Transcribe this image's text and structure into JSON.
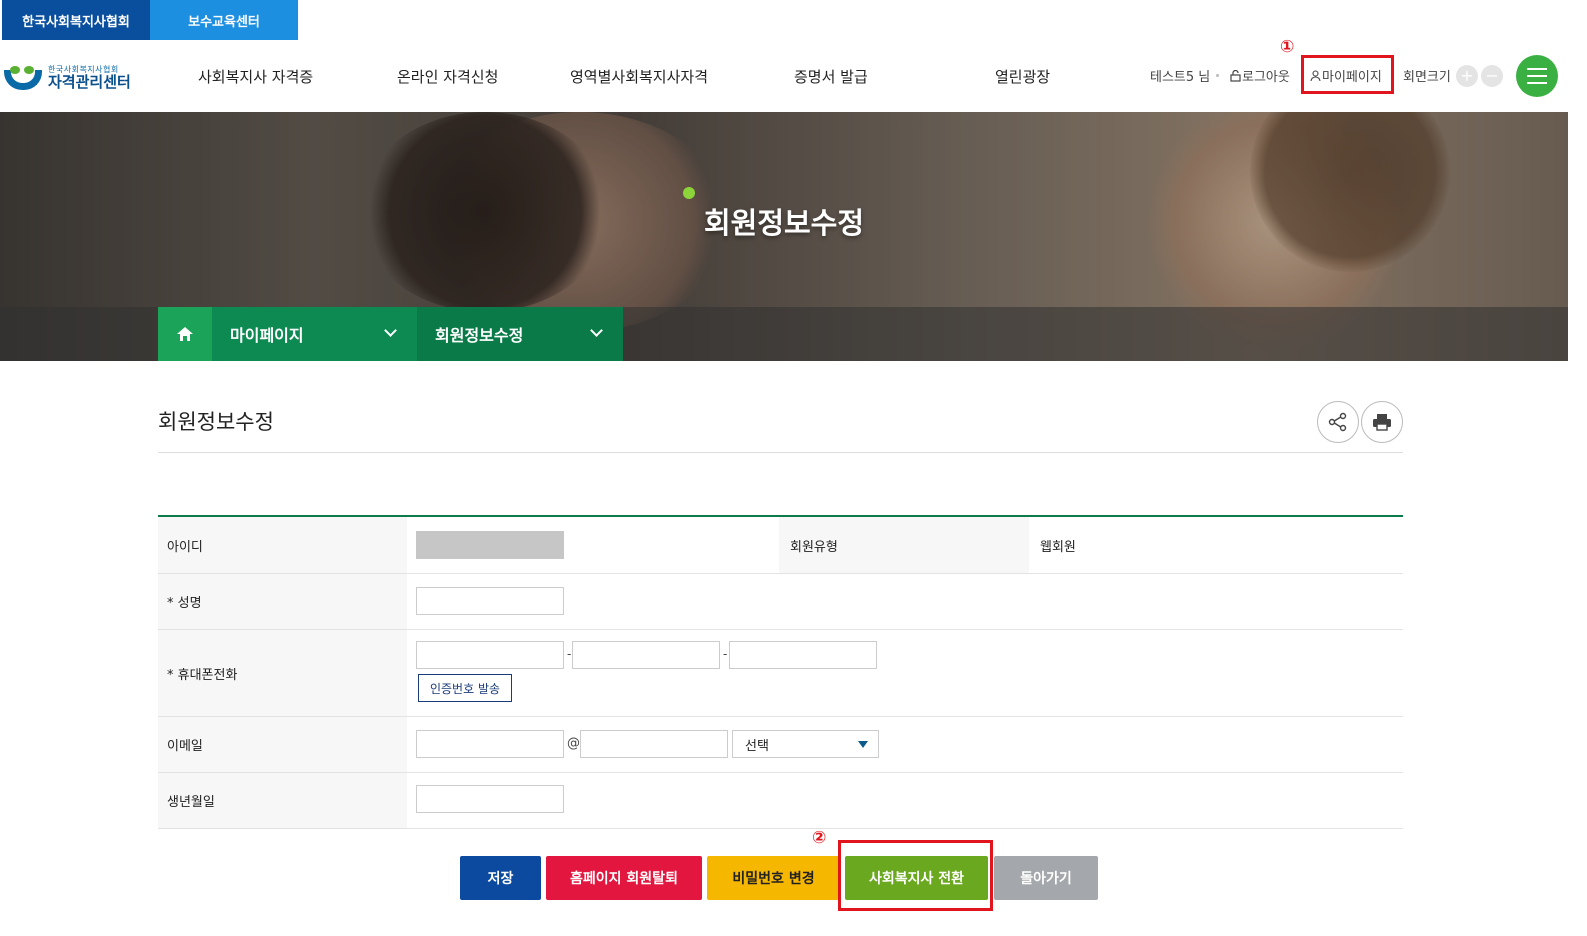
{
  "org_tabs": [
    "한국사회복지사협회",
    "보수교육센터"
  ],
  "logo": {
    "small": "한국사회복지사협회",
    "big": "자격관리센터"
  },
  "gnb": [
    "사회복지사 자격증",
    "온라인 자격신청",
    "영역별사회복지사자격",
    "증명서 발급",
    "열린광장"
  ],
  "util": {
    "user": "테스트5 님",
    "logout": "로그아웃",
    "mypage": "마이페이지",
    "font_size": "회면크기",
    "zoom_in": "+",
    "zoom_out": "−"
  },
  "annotations": {
    "step1": "①",
    "step2": "②"
  },
  "hero": {
    "title": "회원정보수정"
  },
  "breadcrumb": {
    "level1": "마이페이지",
    "level2": "회원정보수정"
  },
  "page": {
    "title": "회원정보수정"
  },
  "form": {
    "id_label": "아이디",
    "member_type_label": "회원유형",
    "member_type_value": "웹회원",
    "name_label": "* 성명",
    "phone_label": "* 휴대폰전화",
    "phone_dash": "-",
    "auth_button": "인증번호 발송",
    "email_label": "이메일",
    "email_at": "@",
    "email_select": "선택",
    "birth_label": "생년월일"
  },
  "buttons": {
    "save": "저장",
    "withdraw": "홈페이지 회원탈퇴",
    "change_pw": "비밀번호 변경",
    "convert": "사회복지사 전환",
    "back": "돌아가기"
  },
  "colors": {
    "save": "#0b4a9e",
    "withdraw": "#e2163e",
    "change_pw": "#f5b700",
    "convert": "#6aa81f",
    "back": "#a4a7ab",
    "highlight": "#e0151e"
  }
}
